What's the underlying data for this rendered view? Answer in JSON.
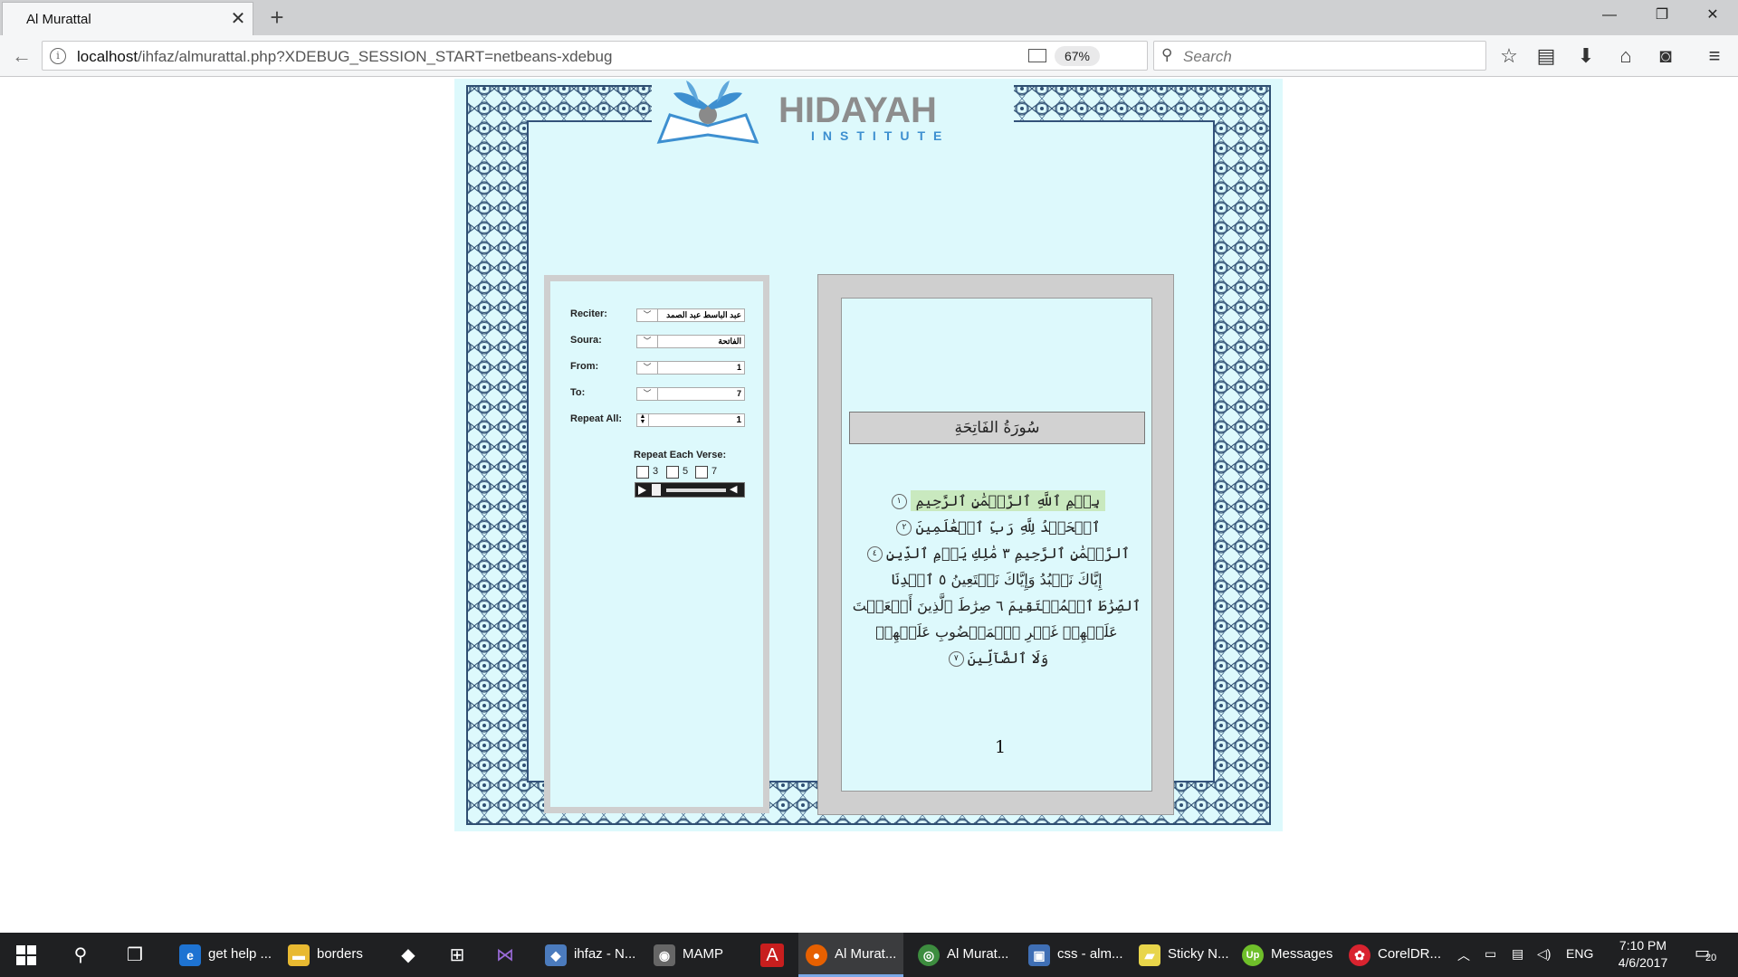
{
  "browser": {
    "tab_title": "Al Murattal",
    "tab_close": "✕",
    "new_tab": "+",
    "url_host": "localhost",
    "url_rest": "/ihfaz/almurattal.php?XDEBUG_SESSION_START=netbeans-xdebug",
    "zoom": "67%",
    "search_placeholder": "Search"
  },
  "logo": {
    "name": "HIDAYAH",
    "subtitle": "INSTITUTE"
  },
  "controls": {
    "reciter_label": "Reciter:",
    "reciter_value": "عبد الباسط عبد الصمد",
    "soura_label": "Soura:",
    "soura_value": "الفاتحة",
    "from_label": "From:",
    "from_value": "1",
    "to_label": "To:",
    "to_value": "7",
    "repeat_all_label": "Repeat All:",
    "repeat_all_value": "1",
    "repeat_each_label": "Repeat Each Verse:",
    "repeat_options": [
      "3",
      "5",
      "7"
    ]
  },
  "mushaf": {
    "surah_title": "سُورَةُ الفَاتِحَةِ",
    "lines": [
      {
        "text": "بِسۡمِ ٱللَّهِ ٱلرَّحۡمَٰنِ ٱلرَّحِيمِ",
        "num": "١"
      },
      {
        "text": "ٱلۡحَمۡدُ لِلَّهِ رَبِّ ٱلۡعَٰلَمِينَ",
        "num": "٢"
      },
      {
        "text": "ٱلرَّحۡمَٰنِ ٱلرَّحِيمِ ٣ مَٰلِكِ يَوۡمِ ٱلدِّينِ",
        "num": "٤"
      },
      {
        "text": "إِيَّاكَ نَعۡبُدُ وَإِيَّاكَ نَسۡتَعِينُ ٥ ٱهۡدِنَا",
        "num": ""
      },
      {
        "text": "ٱلصِّرَٰطَ ٱلۡمُسۡتَقِيمَ ٦ صِرَٰطَ ٱلَّذِينَ أَنۡعَمۡتَ",
        "num": ""
      },
      {
        "text": "عَلَيۡهِمۡ غَيۡرِ ٱلۡمَغۡضُوبِ عَلَيۡهِمۡ",
        "num": ""
      },
      {
        "text": "وَلَا ٱلضَّآلِّينَ",
        "num": "٧"
      }
    ],
    "page_number": "1"
  },
  "taskbar": {
    "apps": [
      {
        "label": "get help ...",
        "icon": "edge-icon",
        "glyph": "e",
        "color": "#1e73d2"
      },
      {
        "label": "borders",
        "icon": "folder-icon",
        "glyph": "▬",
        "color": "#e8b931"
      },
      {
        "label": "ihfaz - N...",
        "icon": "netbeans-icon",
        "glyph": "◆",
        "color": "#4b7bbd"
      },
      {
        "label": "MAMP",
        "icon": "mamp-icon",
        "glyph": "◉",
        "color": "#666666"
      },
      {
        "label": "Al Murat...",
        "icon": "firefox-icon",
        "glyph": "●",
        "color": "#e66000"
      },
      {
        "label": "Al Murat...",
        "icon": "chrome-icon",
        "glyph": "◎",
        "color": "#3d8d3f"
      },
      {
        "label": "css - alm...",
        "icon": "filezilla-icon",
        "glyph": "▣",
        "color": "#3f6fb5"
      },
      {
        "label": "Sticky N...",
        "icon": "sticky-notes-icon",
        "glyph": "▰",
        "color": "#e8d54a"
      },
      {
        "label": "Messages",
        "icon": "upwork-icon",
        "glyph": "Up",
        "color": "#6fbf2a"
      },
      {
        "label": "CorelDR...",
        "icon": "coreldraw-icon",
        "glyph": "✿",
        "color": "#d9232f"
      }
    ],
    "lang": "ENG",
    "time": "7:10 PM",
    "date": "4/6/2017",
    "notifications": "20"
  }
}
